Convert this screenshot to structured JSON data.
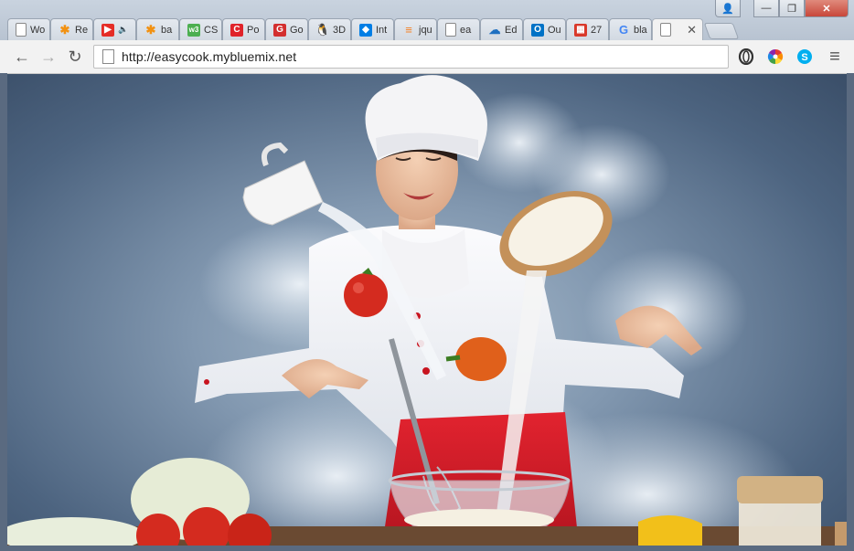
{
  "browser": {
    "tabs": [
      {
        "label": "Wo",
        "icon": "page-icon",
        "color": "#999999",
        "glyph": ""
      },
      {
        "label": "Re",
        "icon": "asterisk-icon",
        "color": "#f29111",
        "glyph": "✱"
      },
      {
        "label": "",
        "icon": "youtube-icon",
        "color": "#e52d27",
        "glyph": "▶",
        "extra": "🔈"
      },
      {
        "label": "ba",
        "icon": "asterisk-icon",
        "color": "#f29111",
        "glyph": "✱"
      },
      {
        "label": "CS",
        "icon": "w3-icon",
        "color": "#4caf50",
        "glyph": "w3"
      },
      {
        "label": "Po",
        "icon": "c-icon",
        "color": "#e0232a",
        "glyph": "C"
      },
      {
        "label": "Go",
        "icon": "g-logo-icon",
        "color": "#d32f2f",
        "glyph": "G"
      },
      {
        "label": "3D",
        "icon": "linux-penguin-icon",
        "color": "#222222",
        "glyph": "🐧"
      },
      {
        "label": "Int",
        "icon": "dropbox-icon",
        "color": "#007ee5",
        "glyph": "◆"
      },
      {
        "label": "jqu",
        "icon": "stack-icon",
        "color": "#f48024",
        "glyph": "≡"
      },
      {
        "label": "ea",
        "icon": "page-icon",
        "color": "#999999",
        "glyph": ""
      },
      {
        "label": "Ed",
        "icon": "cloud-icon",
        "color": "#1f70c1",
        "glyph": "☁"
      },
      {
        "label": "Ou",
        "icon": "outlook-icon",
        "color": "#0072c6",
        "glyph": "O"
      },
      {
        "label": "27",
        "icon": "calendar-icon",
        "color": "#d9392b",
        "glyph": "▦"
      },
      {
        "label": "bla",
        "icon": "google-icon",
        "color": "#4285f4",
        "glyph": "G"
      }
    ],
    "active_tab": {
      "label": "",
      "icon": "page-icon",
      "close": "✕"
    },
    "window_controls": {
      "user": "👤",
      "minimize": "—",
      "maximize": "❐",
      "close": "✕"
    },
    "nav": {
      "back": "←",
      "forward": "→",
      "reload": "↻"
    },
    "address": "http://easycook.mybluemix.net",
    "extensions": [
      {
        "name": "opera-icon",
        "glyph": "O",
        "color": "#333333"
      },
      {
        "name": "color-wheel-icon",
        "glyph": "●",
        "color": "#e53935"
      },
      {
        "name": "skype-icon",
        "glyph": "S",
        "color": "#00aff0"
      }
    ],
    "menu": "≡"
  },
  "hero": {
    "image_alt": "Chef in white hat and red apron tossing ingredients",
    "colors": {
      "apron": "#d81e2a",
      "tomato": "#d42b1f",
      "pepper": "#e0601b",
      "bowl": "#d9c4a0",
      "milk": "#f5f1e8"
    }
  }
}
